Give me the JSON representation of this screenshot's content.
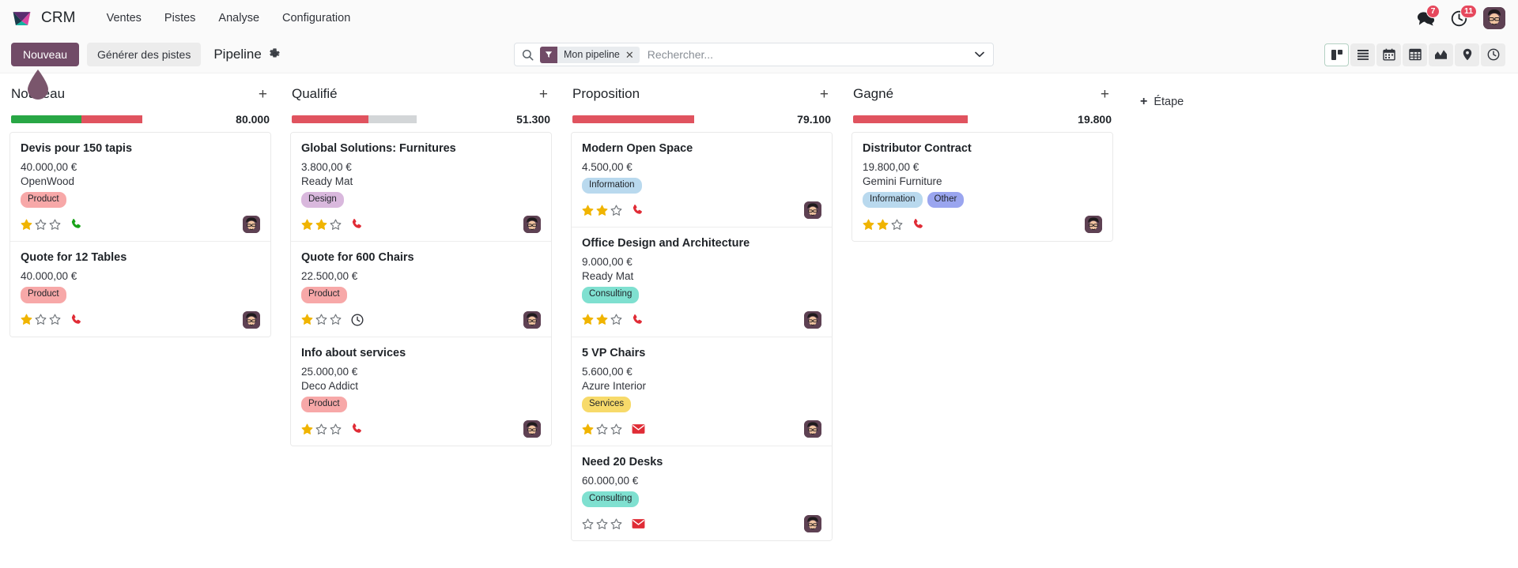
{
  "app": {
    "name": "CRM",
    "logo_icon": "odoo-diamond-logo"
  },
  "navbar": {
    "menus": [
      {
        "label": "Ventes"
      },
      {
        "label": "Pistes"
      },
      {
        "label": "Analyse"
      },
      {
        "label": "Configuration"
      }
    ],
    "systray": {
      "messages_icon": "chat-bubbles-icon",
      "messages_count": "7",
      "activities_icon": "clock-icon",
      "activities_count": "11",
      "avatar_icon": "user-avatar"
    }
  },
  "control_panel": {
    "new_label": "Nouveau",
    "generate_leads_label": "Générer des pistes",
    "breadcrumb_title": "Pipeline",
    "settings_icon": "gear-icon",
    "search": {
      "icon": "search-icon",
      "facet_icon": "filter-icon",
      "facet_label": "Mon pipeline",
      "facet_close_icon": "close-icon",
      "placeholder": "Rechercher...",
      "dropdown_icon": "chevron-down-icon"
    },
    "views": [
      {
        "name": "kanban",
        "icon": "kanban-icon",
        "active": true
      },
      {
        "name": "list",
        "icon": "list-icon",
        "active": false
      },
      {
        "name": "calendar",
        "icon": "calendar-icon",
        "active": false
      },
      {
        "name": "pivot",
        "icon": "pivot-table-icon",
        "active": false
      },
      {
        "name": "graph",
        "icon": "graph-icon",
        "active": false
      },
      {
        "name": "map",
        "icon": "map-pin-icon",
        "active": false
      },
      {
        "name": "activity",
        "icon": "activity-clock-icon",
        "active": false
      }
    ]
  },
  "kanban": {
    "add_stage_label": "Étape",
    "add_stage_icon": "plus-icon",
    "column_add_icon": "plus-icon",
    "colors": {
      "brand": "#714b67",
      "progress_green": "#28a745",
      "progress_red": "#e0535f",
      "progress_grey": "#d3d6d8",
      "badge_red": "#e6485d",
      "star_filled": "#f0b400",
      "activity_overdue": "#e02c36",
      "activity_today": "#19a319",
      "activity_planned": "#31343b"
    },
    "columns": [
      {
        "title": "Nouveau",
        "total": "80.000",
        "progress": [
          {
            "color": "#28a745",
            "percent": 48
          },
          {
            "color": "#e0535f",
            "percent": 41
          }
        ],
        "cards": [
          {
            "title": "Devis pour 150 tapis",
            "amount": "40.000,00 €",
            "partner": "OpenWood",
            "tags": [
              {
                "label": "Product",
                "bg": "#f7a8a8",
                "fg": "#1f2328"
              }
            ],
            "stars": 1,
            "activity_icon": "phone-icon",
            "activity_state": "today",
            "avatar_icon": "user-avatar"
          },
          {
            "title": "Quote for 12 Tables",
            "amount": "40.000,00 €",
            "partner": "",
            "tags": [
              {
                "label": "Product",
                "bg": "#f7a8a8",
                "fg": "#1f2328"
              }
            ],
            "stars": 1,
            "activity_icon": "phone-icon",
            "activity_state": "overdue",
            "avatar_icon": "user-avatar"
          }
        ]
      },
      {
        "title": "Qualifié",
        "total": "51.300",
        "progress": [
          {
            "color": "#e0535f",
            "percent": 52
          },
          {
            "color": "#d3d6d8",
            "percent": 33
          }
        ],
        "cards": [
          {
            "title": "Global Solutions: Furnitures",
            "amount": "3.800,00 €",
            "partner": "Ready Mat",
            "tags": [
              {
                "label": "Design",
                "bg": "#d9b8dd",
                "fg": "#1f2328"
              }
            ],
            "stars": 2,
            "activity_icon": "phone-icon",
            "activity_state": "overdue",
            "avatar_icon": "user-avatar"
          },
          {
            "title": "Quote for 600 Chairs",
            "amount": "22.500,00 €",
            "partner": "",
            "tags": [
              {
                "label": "Product",
                "bg": "#f7a8a8",
                "fg": "#1f2328"
              }
            ],
            "stars": 1,
            "activity_icon": "clock-icon",
            "activity_state": "planned",
            "avatar_icon": "user-avatar"
          },
          {
            "title": "Info about services",
            "amount": "25.000,00 €",
            "partner": "Deco Addict",
            "tags": [
              {
                "label": "Product",
                "bg": "#f7a8a8",
                "fg": "#1f2328"
              }
            ],
            "stars": 1,
            "activity_icon": "phone-icon",
            "activity_state": "overdue",
            "avatar_icon": "user-avatar"
          }
        ]
      },
      {
        "title": "Proposition",
        "total": "79.100",
        "progress": [
          {
            "color": "#e0535f",
            "percent": 83
          }
        ],
        "cards": [
          {
            "title": "Modern Open Space",
            "amount": "4.500,00 €",
            "partner": "",
            "tags": [
              {
                "label": "Information",
                "bg": "#b9d9ee",
                "fg": "#1f2328"
              }
            ],
            "stars": 2,
            "activity_icon": "phone-icon",
            "activity_state": "overdue",
            "avatar_icon": "user-avatar"
          },
          {
            "title": "Office Design and Architecture",
            "amount": "9.000,00 €",
            "partner": "Ready Mat",
            "tags": [
              {
                "label": "Consulting",
                "bg": "#7fe0d0",
                "fg": "#1f2328"
              }
            ],
            "stars": 2,
            "activity_icon": "phone-icon",
            "activity_state": "overdue",
            "avatar_icon": "user-avatar"
          },
          {
            "title": "5 VP Chairs",
            "amount": "5.600,00 €",
            "partner": "Azure Interior",
            "tags": [
              {
                "label": "Services",
                "bg": "#f7da6a",
                "fg": "#1f2328"
              }
            ],
            "stars": 1,
            "activity_icon": "envelope-icon",
            "activity_state": "overdue",
            "avatar_icon": "user-avatar"
          },
          {
            "title": "Need 20 Desks",
            "amount": "60.000,00 €",
            "partner": "",
            "tags": [
              {
                "label": "Consulting",
                "bg": "#7fe0d0",
                "fg": "#1f2328"
              }
            ],
            "stars": 0,
            "activity_icon": "envelope-icon",
            "activity_state": "overdue",
            "avatar_icon": "user-avatar"
          }
        ]
      },
      {
        "title": "Gagné",
        "total": "19.800",
        "progress": [
          {
            "color": "#e0535f",
            "percent": 78
          }
        ],
        "cards": [
          {
            "title": "Distributor Contract",
            "amount": "19.800,00 €",
            "partner": "Gemini Furniture",
            "tags": [
              {
                "label": "Information",
                "bg": "#b9d9ee",
                "fg": "#1f2328"
              },
              {
                "label": "Other",
                "bg": "#9aa5ef",
                "fg": "#1f2328"
              }
            ],
            "stars": 2,
            "activity_icon": "phone-icon",
            "activity_state": "overdue",
            "avatar_icon": "user-avatar"
          }
        ]
      }
    ]
  },
  "cursor": {
    "icon": "pointer-marker",
    "color": "#7a566c"
  }
}
